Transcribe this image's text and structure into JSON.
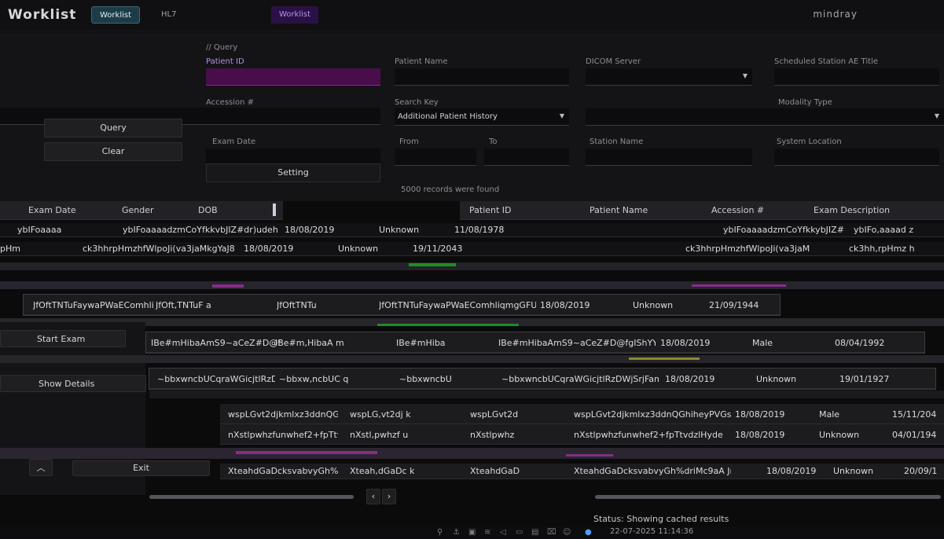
{
  "app": {
    "title": "Worklist",
    "brand": "mindray"
  },
  "tabs": [
    {
      "label": "Worklist",
      "active": true
    },
    {
      "label": "HL7",
      "active": false
    },
    {
      "label": "Worklist",
      "active": false
    }
  ],
  "query": {
    "section_label": "// Query",
    "patient_id_label": "Patient ID",
    "patient_name_label": "Patient Name",
    "dicom_server_label": "DICOM Server",
    "scheduled_ae_label": "Scheduled Station AE Title",
    "accession_label": "Accession #",
    "search_key_label": "Search Key",
    "modality_label": "Modality Type",
    "additional_history_label": "Additional Patient History",
    "exam_date_label": "Exam Date",
    "from_label": "From",
    "to_label": "To",
    "station_name_label": "Station Name",
    "system_location_label": "System Location",
    "records_found": "5000 records were found",
    "query_button": "Query",
    "clear_button": "Clear",
    "setting_button": "Setting"
  },
  "left_actions": {
    "start_exam": "Start Exam",
    "show_details": "Show Details",
    "exit": "Exit"
  },
  "grid": {
    "left_headers": [
      "Exam Date",
      "Gender",
      "DOB"
    ],
    "right_headers": [
      "Patient ID",
      "Patient Name",
      "Accession #",
      "Exam Description"
    ],
    "rows": [
      {
        "c1": "ybIFoaaaa",
        "c2": "ybIFoaaaadzmCoYfkkvbJIZ#dr)udeh",
        "c3": "18/08/2019",
        "c4": "Unknown",
        "c5": "11/08/1978",
        "c6": "ybIFoaaaadzmCoYfkkybJIZ#",
        "c7": "ybIFo,aaaad z"
      },
      {
        "c1": "pHm",
        "c2": "ck3hhrpHmzhfWlpoJi(va3jaMkgYaJ8",
        "c3": "18/08/2019",
        "c4": "Unknown",
        "c5": "19/11/2043",
        "c6": "ck3hhrpHmzhfWlpoJi(va3jaM",
        "c7": "ck3hh,rpHmz h"
      },
      {
        "c1": "JfOftTNTuFaywaPWaEComhli",
        "c2": "JfOft,TNTuF a",
        "c3": "JfOftTNTu",
        "c4": "JfOftTNTuFaywaPWaEComhliqmgGFUA",
        "c5": "18/08/2019",
        "c6": "Unknown",
        "c7": "21/09/1944"
      },
      {
        "c1": "IBe#mHibaAmS9~aCeZ#D@f",
        "c2": "IBe#m,HibaA m",
        "c3": "IBe#mHiba",
        "c4": "IBe#mHibaAmS9~aCeZ#D@fgIShYYh8I",
        "c5": "18/08/2019",
        "c6": "Male",
        "c7": "08/04/1992"
      },
      {
        "c1": "~bbxwncbUCqraWGicjtlRzD...",
        "c2": "~bbxw,ncbUC q",
        "c3": "~bbxwncbU",
        "c4": "~bbxwncbUCqraWGicjtlRzDWjSrjFam",
        "c5": "18/08/2019",
        "c6": "Unknown",
        "c7": "19/01/1927"
      },
      {
        "c1": "wspLGvt2djkmlxz3ddnQGhih...",
        "c2": "wspLG,vt2dj k",
        "c3": "wspLGvt2d",
        "c4": "wspLGvt2djkmlxz3ddnQGhiheyPVGs#",
        "c5": "18/08/2019",
        "c6": "Male",
        "c7": "15/11/204"
      },
      {
        "c1": "nXstlpwhzfunwhef2+fpTtvdz...",
        "c2": "nXstl,pwhzf u",
        "c3": "nXstlpwhz",
        "c4": "nXstlpwhzfunwhef2+fpTtvdzlHyde",
        "c5": "18/08/2019",
        "c6": "Unknown",
        "c7": "04/01/194"
      },
      {
        "c1": "XteahdGaDcksvabvyGh%driM...",
        "c2": "Xteah,dGaDc k",
        "c3": "XteahdGaD",
        "c4": "XteahdGaDcksvabvyGh%driMc9aA Jrd",
        "c5": "18/08/2019",
        "c6": "Unknown",
        "c7": "20/09/1"
      }
    ]
  },
  "status": {
    "text": "Status: Showing cached results",
    "datetime": "22-07-2025  11:14:36"
  },
  "colors": {
    "accent": "#2f6d80",
    "magenta": "#4a0d4c",
    "green": "#1f8a2c"
  }
}
